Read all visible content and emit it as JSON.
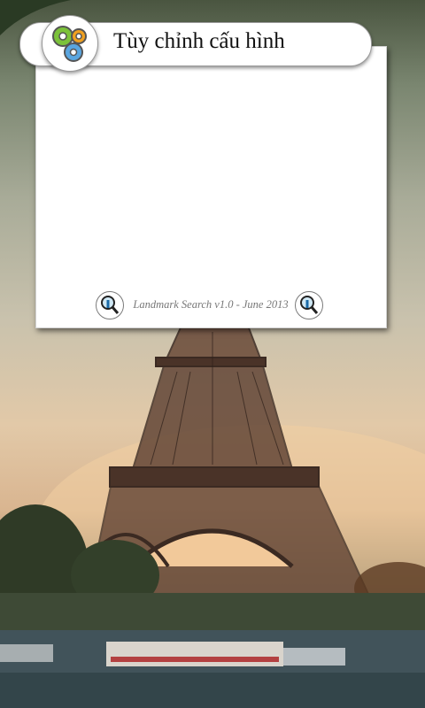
{
  "header": {
    "title": "Tùy chỉnh cấu hình",
    "icon": "gears-icon"
  },
  "panel": {
    "footer_text": "Landmark Search  v1.0 - June 2013",
    "left_icon": "landmark-search-icon",
    "right_icon": "landmark-search-icon"
  },
  "background": {
    "subject": "eiffel-tower-photo"
  }
}
